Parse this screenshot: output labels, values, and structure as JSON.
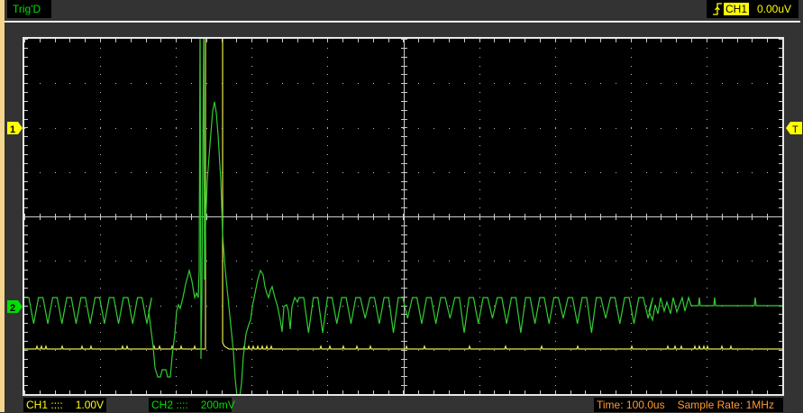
{
  "status": {
    "trigger_state": "Trig'D"
  },
  "trigger": {
    "icon": "rising-edge-icon",
    "source": "CH1",
    "level": "0.00uV"
  },
  "markers": {
    "ch1": "1",
    "ch2": "2",
    "trigger": "T"
  },
  "bottom": {
    "ch1_label": "CH1",
    "ch1_coupling": "::::",
    "ch1_scale": "1.00V",
    "ch2_label": "CH2",
    "ch2_coupling": "::::",
    "ch2_scale": "200mV",
    "time": "Time: 100.0us",
    "sample_rate": "Sample Rate: 1MHz"
  },
  "colors": {
    "ch1": "#e8e850",
    "ch2": "#33cc33",
    "marker_ch1": "#ffff00",
    "marker_ch2": "#00dd00",
    "time_text": "#ff9933"
  }
}
